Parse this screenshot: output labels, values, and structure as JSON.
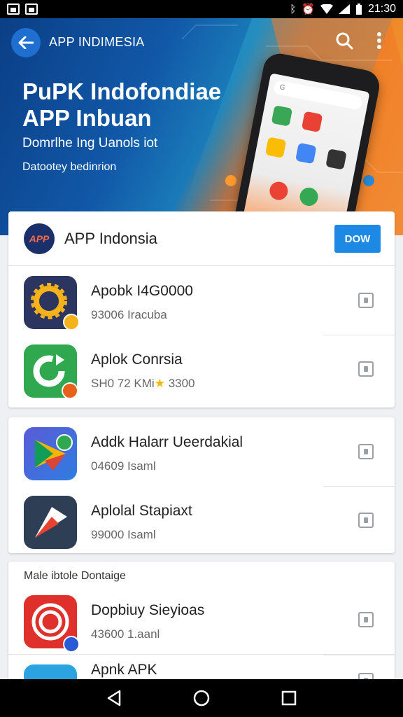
{
  "status_bar": {
    "time": "21:30",
    "left_icons": [
      "image-icon",
      "photo-icon"
    ],
    "right_icons": [
      "bluetooth-icon",
      "alarm-icon",
      "wifi-icon",
      "signal-icon",
      "battery-icon"
    ]
  },
  "header": {
    "title": "APP INDIMESIA"
  },
  "hero": {
    "headline": "PuPK Indofondiae APP Inbuan",
    "subtitle": "Domrlhe Ing Uanols iot",
    "caption": "Datootey bedinrion"
  },
  "featured_card": {
    "brand_logo_text": "APP",
    "brand_name": "APP Indonsia",
    "action_label": "DOW",
    "items": [
      {
        "title": "Apobk I4G0000",
        "subtitle": "93006  Iracuba"
      },
      {
        "title": "Aplok Conrsia",
        "subtitle": "SH0 72  KMi",
        "rating": "3300"
      }
    ]
  },
  "second_card": {
    "items": [
      {
        "title": "Addk Halarr Ueerdakial",
        "subtitle": "04609  Isaml"
      },
      {
        "title": "Aplolal Stapiaxt",
        "subtitle": "99000  Isaml"
      }
    ]
  },
  "third_card": {
    "section_label": "Male ibtole Dontaige",
    "items": [
      {
        "title": "Dopbiuy Sieyioas",
        "subtitle": "43600  1.aanl"
      },
      {
        "title": "Apnk APK",
        "subtitle": ""
      }
    ]
  },
  "nav_bar": {
    "buttons": [
      "back-triangle-icon",
      "home-circle-icon",
      "recents-square-icon"
    ]
  },
  "colors": {
    "primary": "#1e88e5",
    "hero_blue": "#0b3f86",
    "hero_orange": "#f08c2a",
    "status_bar": "#000000"
  }
}
